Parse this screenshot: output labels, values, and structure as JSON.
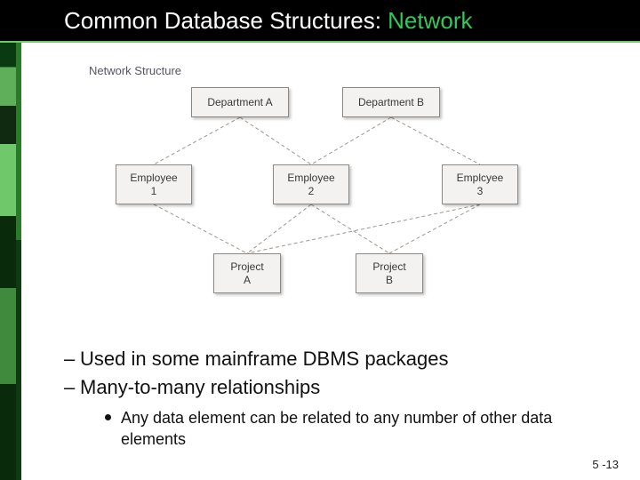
{
  "title_prefix": "Common Database Structures: ",
  "title_highlight": "Network",
  "diagram": {
    "caption": "Network Structure",
    "nodes": {
      "deptA": "Department A",
      "deptB": "Department B",
      "emp1": "Employee\n1",
      "emp2": "Employee\n2",
      "emp3": "Emplcyee\n3",
      "projA": "Project\nA",
      "projB": "Project\nB"
    }
  },
  "bullets": {
    "dash1": "Used in some mainframe DBMS packages",
    "dash2": "Many-to-many relationships",
    "dot1": "Any data element can be related to any number of other data elements"
  },
  "slide_number": "5 -13"
}
